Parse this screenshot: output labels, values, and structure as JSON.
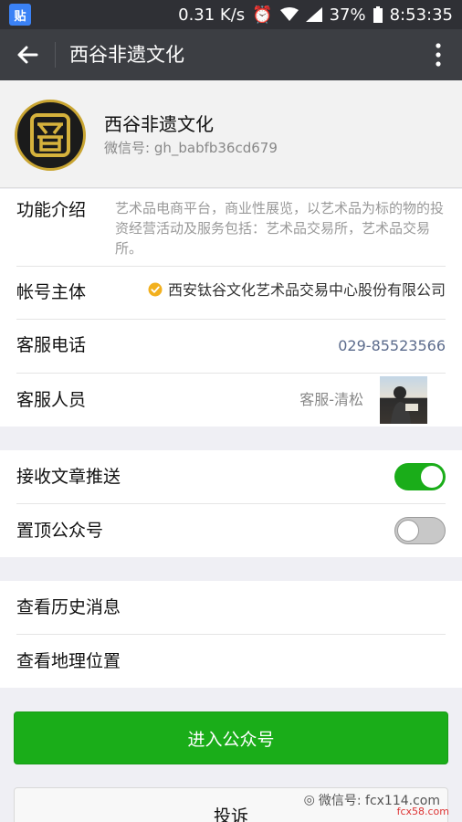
{
  "status_bar": {
    "app_icon_text": "贴",
    "speed": "0.31 K/s",
    "battery": "37%",
    "time": "8:53:35"
  },
  "nav": {
    "title": "西谷非遗文化"
  },
  "profile": {
    "name": "西谷非遗文化",
    "wechat_id": "微信号: gh_babfb36cd679"
  },
  "info": {
    "intro_label": "功能介绍",
    "intro_text": "艺术品电商平台，商业性展览，以艺术品为标的物的投资经营活动及服务包括：艺术品交易所，艺术品交易所。",
    "subject_label": "帐号主体",
    "subject_value": "西安钛谷文化艺术品交易中心股份有限公司",
    "phone_label": "客服电话",
    "phone_value": "029-85523566",
    "staff_label": "客服人员",
    "staff_value": "客服-清松"
  },
  "settings": {
    "receive_label": "接收文章推送",
    "receive_on": true,
    "pin_label": "置顶公众号",
    "pin_on": false
  },
  "history": {
    "history_label": "查看历史消息",
    "location_label": "查看地理位置"
  },
  "buttons": {
    "enter_label": "进入公众号",
    "complain_label": "投诉"
  },
  "watermark": {
    "text": "微信号: fcx114.com",
    "site": "fcx58.com"
  },
  "colors": {
    "accent_green": "#1aad19",
    "navbar": "#3c3e43",
    "statusbar": "#2f3035"
  }
}
